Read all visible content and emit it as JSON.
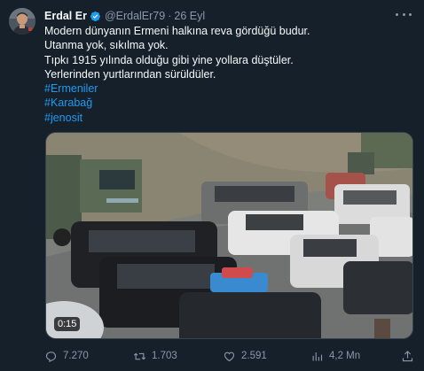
{
  "author": {
    "name": "Erdal Er",
    "handle": "@ErdalEr79",
    "separator": "·",
    "date": "26 Eyl",
    "verified_color": "#1d9bf0"
  },
  "tweet": {
    "lines": [
      "Modern dünyanın Ermeni halkına reva gördüğü budur.",
      "Utanma yok, sıkılma yok.",
      "Tıpkı 1915 yılında olduğu gibi yine yollara düştüler.",
      "Yerlerinden yurtlarından sürüldüler."
    ],
    "hashtags": [
      "#Ermeniler",
      "#Karabağ",
      "#jenosit"
    ]
  },
  "media": {
    "duration": "0:15"
  },
  "metrics": {
    "replies": "7.270",
    "retweets": "1.703",
    "likes": "2.591",
    "views": "4,2 Mn"
  },
  "icons": {
    "reply": "reply-icon",
    "retweet": "retweet-icon",
    "like": "heart-icon",
    "views": "views-icon",
    "share": "share-icon",
    "more": "more-icon",
    "verified": "verified-badge-icon"
  },
  "colors": {
    "background": "#15202b",
    "text": "#f7f9f9",
    "muted": "#8b98a5",
    "accent": "#1d9bf0"
  }
}
